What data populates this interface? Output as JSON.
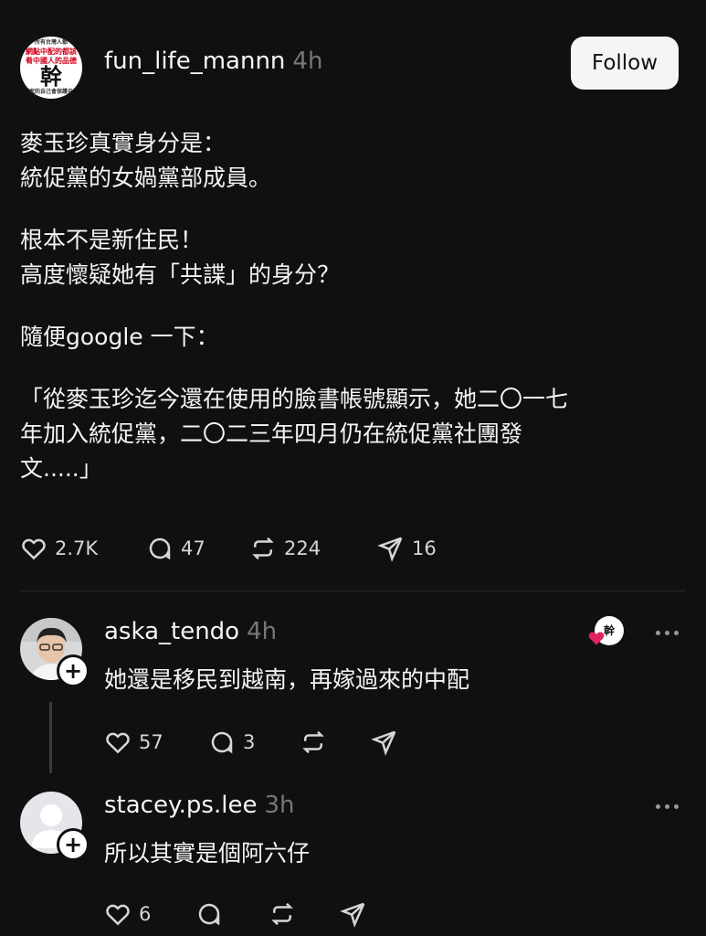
{
  "post": {
    "username": "fun_life_mannn",
    "time": "4h",
    "follow_label": "Follow",
    "avatar_lines": [
      "所有台灣人都",
      "網點中配的都該",
      "肴中國人的品德",
      "幹",
      "國家的自己會保護自己"
    ],
    "paragraphs": [
      [
        "麥玉珍真實身分是：",
        "統促黨的女媧黨部成員。"
      ],
      [
        "根本不是新住民！",
        "高度懷疑她有「共諜」的身分？"
      ],
      [
        "隨便google 一下："
      ],
      [
        "「從麥玉珍迄今還在使用的臉書帳號顯示，她二〇一七",
        "年加入統促黨，二〇二三年四月仍在統促黨社團發",
        "文.....」"
      ]
    ],
    "stats": {
      "likes": "2.7K",
      "comments": "47",
      "reposts": "224",
      "shares": "16"
    }
  },
  "replies": [
    {
      "username": "aska_tendo",
      "time": "4h",
      "text": "她還是移民到越南，再嫁過來的中配",
      "stats": {
        "likes": "57",
        "comments": "3"
      }
    },
    {
      "username": "stacey.ps.lee",
      "time": "3h",
      "text": "所以其實是個阿六仔",
      "stats": {
        "likes": "6"
      }
    }
  ],
  "colors": {
    "background": "#101010",
    "text": "#f3f5f7",
    "muted": "#777777",
    "heart": "#e0245e"
  }
}
